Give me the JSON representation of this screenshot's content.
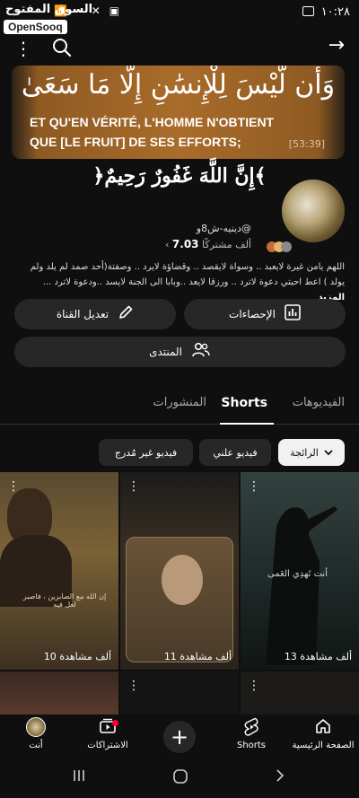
{
  "status_bar": {
    "time": "١٠:٢٨",
    "left_icons": "📶 ⌁ ✕ ▣"
  },
  "watermark": {
    "arabic": "السوق المفتوح",
    "logo": "OpenSooq"
  },
  "toolbar": {
    "more_icon": "⋮",
    "search_icon": "⚲",
    "forward_icon": "→"
  },
  "banner": {
    "arabic_verse": "وَأَن لَّيْسَ لِلْإِنسَٰنِ إِلَّا مَا سَعَىٰ",
    "french_line1": "ET QU'EN VÉRITÉ, L'HOMME N'OBTIENT",
    "french_line2": "QUE [LE FRUIT] DE SES EFFORTS;",
    "reference": "[53:39]"
  },
  "channel": {
    "name": "﴿إِنَّ اللَّهَ غَفُورٌ رَحِيمٌ﴾",
    "handle": "@دينيه-ش8و",
    "subscribers_label": "ألف مشتركًا",
    "subscribers_count": "7.03",
    "chevron": "‹",
    "description": "اللهم يامن غيرة لايعبد .. وسواة لايقصد .. وقضاؤة لايرد .. وصفتة(أحد صمد لم يلد ولم يولد ) اعط احبتي دعوة لاترد .. ورزقا لايعد ..وبابا الى الجنة لايسد ..ودعوة لاترد ...",
    "more_label": "المزيد"
  },
  "buttons": {
    "stats": "الإحصاءات",
    "edit": "تعديل القناة",
    "forum": "المنتدى"
  },
  "tabs": {
    "videos": "الفيديوهات",
    "shorts": "Shorts",
    "posts": "المنشورات"
  },
  "chips": {
    "popular": "الرائجة",
    "public": "فيديو علني",
    "unlisted": "فيديو غير مُدرج"
  },
  "shorts": [
    {
      "views": "13 ألف مشاهدة",
      "caption": "أنت تَهدِي العَمى"
    },
    {
      "views": "11 ألف مشاهدة",
      "caption": ""
    },
    {
      "views": "10 ألف مشاهدة",
      "caption": "إن الله مع الصابرين ، فاصبر لعل فيه"
    }
  ],
  "bottom_nav": {
    "home": "الصفحة الرئيسية",
    "shorts": "Shorts",
    "subscriptions": "الاشتراكات",
    "you": "أنت"
  },
  "icons": {
    "home": "home-icon",
    "shorts": "shorts-icon",
    "create": "plus-icon",
    "subscriptions": "subscriptions-icon",
    "stats": "bar-chart-icon",
    "edit": "pencil-icon",
    "forum": "people-icon"
  },
  "colors": {
    "background": "#0f0f0f",
    "pill": "#272727",
    "accent_red": "#ff0033",
    "banner_gold": "#a96c2a"
  }
}
